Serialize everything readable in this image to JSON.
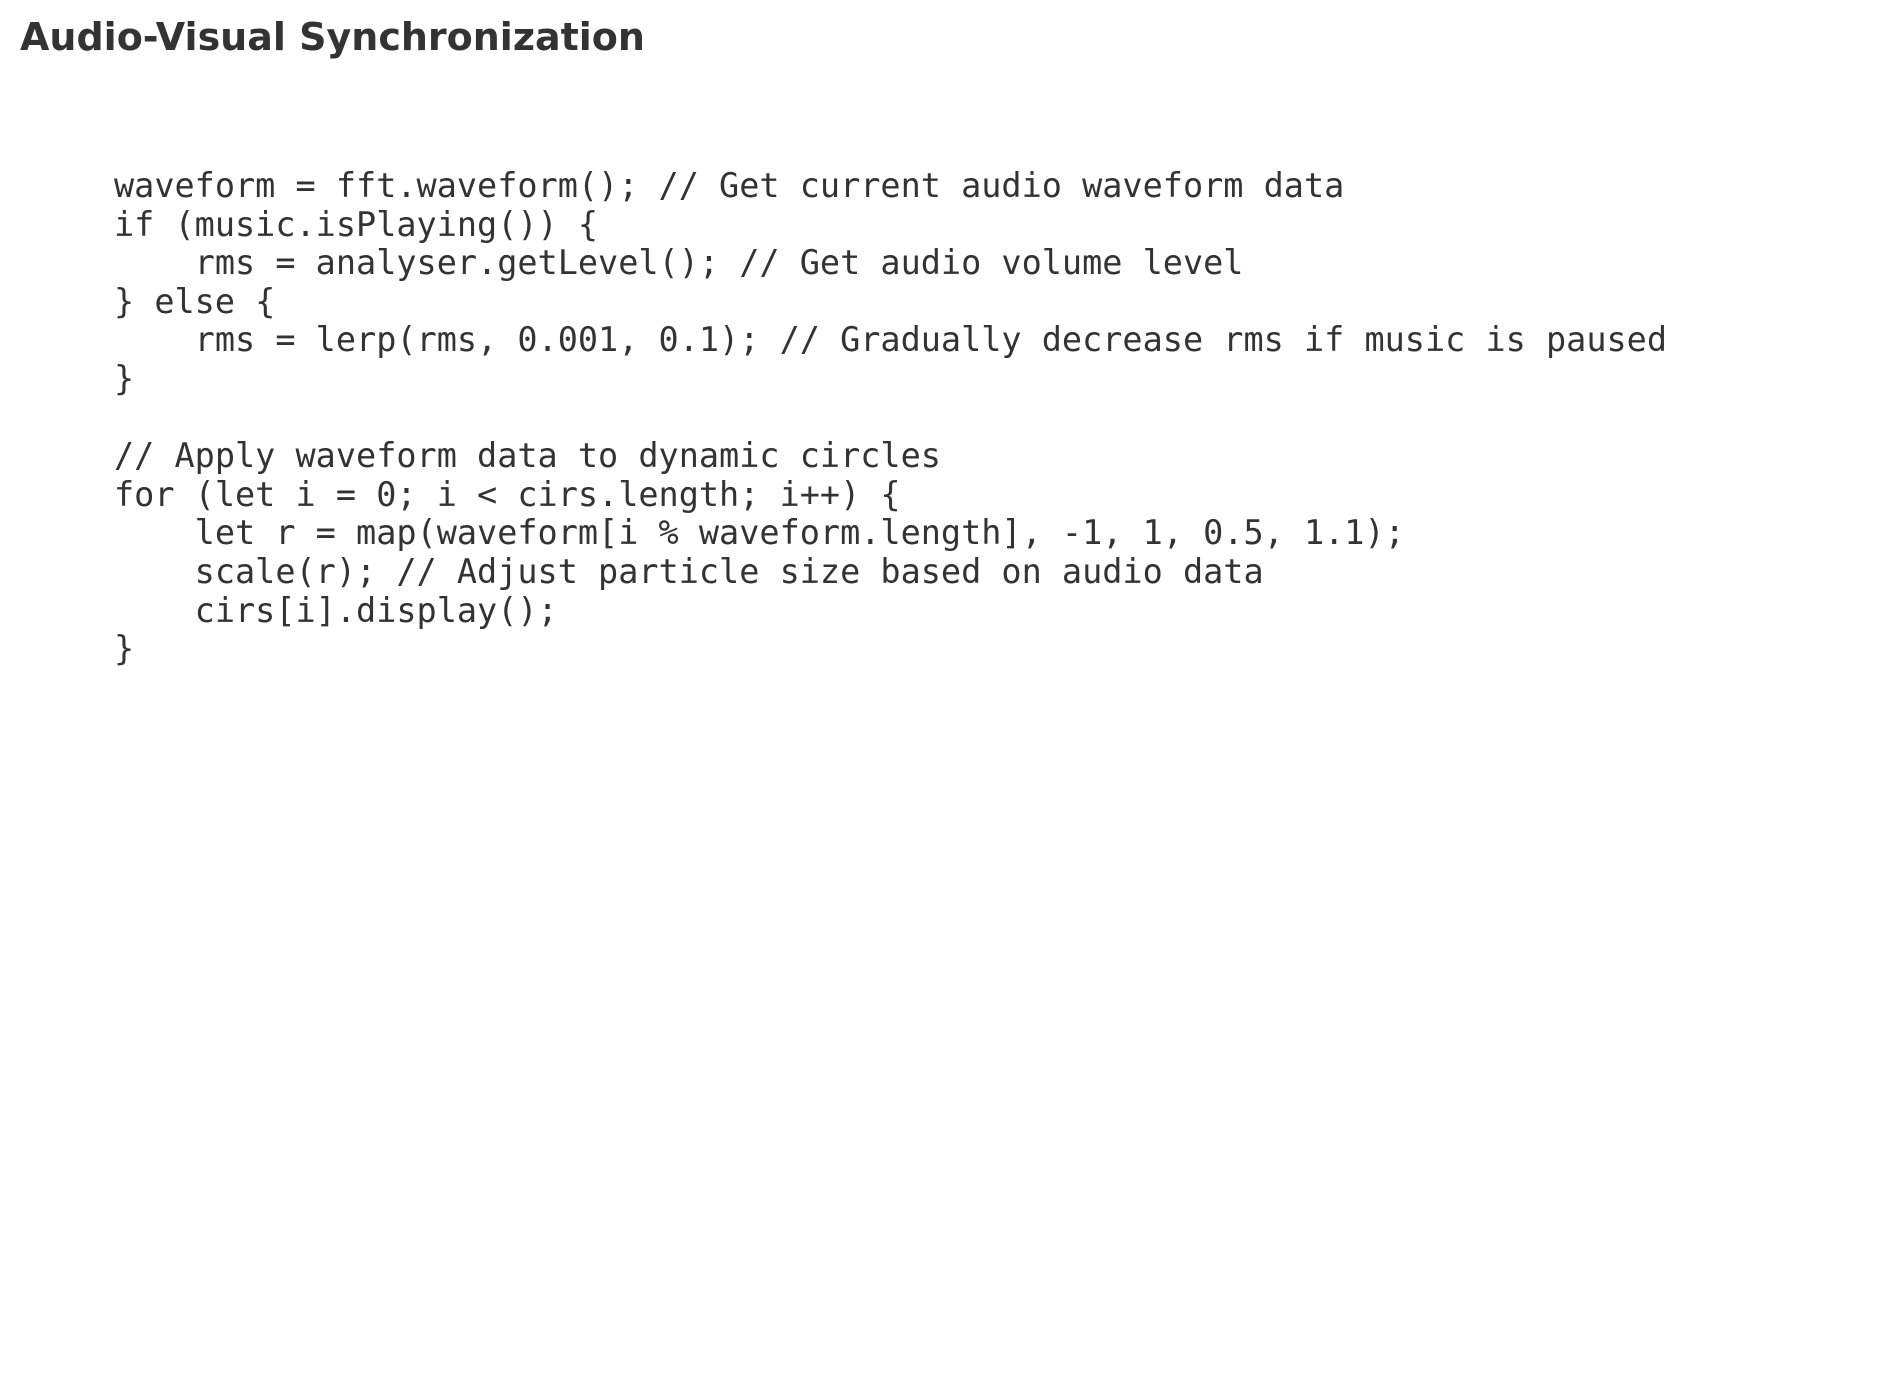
{
  "page": {
    "title": "Audio-Visual Synchronization"
  },
  "code": {
    "language": "javascript",
    "lines": [
      "waveform = fft.waveform(); // Get current audio waveform data",
      "if (music.isPlaying()) {",
      "    rms = analyser.getLevel(); // Get audio volume level",
      "} else {",
      "    rms = lerp(rms, 0.001, 0.1); // Gradually decrease rms if music is paused",
      "}",
      "",
      "// Apply waveform data to dynamic circles",
      "for (let i = 0; i < cirs.length; i++) {",
      "    let r = map(waveform[i % waveform.length], -1, 1, 0.5, 1.1);",
      "    scale(r); // Adjust particle size based on audio data",
      "    cirs[i].display();",
      "}"
    ]
  },
  "colors": {
    "text": "#333333",
    "background": "#ffffff"
  }
}
